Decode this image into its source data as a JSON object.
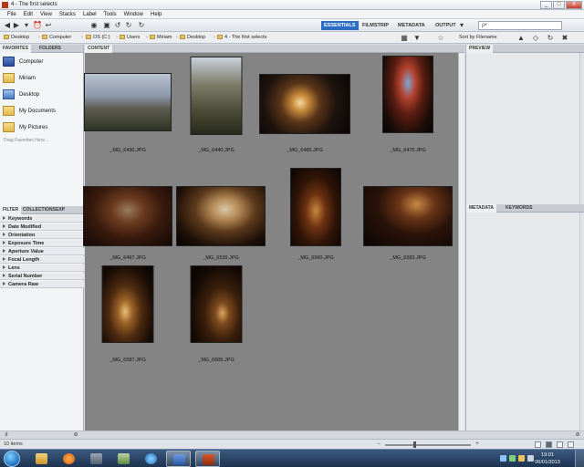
{
  "window": {
    "title": "4 - The first selects",
    "controls": [
      "_",
      "□",
      "X"
    ]
  },
  "menu": [
    "File",
    "Edit",
    "View",
    "Stacks",
    "Label",
    "Tools",
    "Window",
    "Help"
  ],
  "toolbar": {
    "workspaces": [
      "ESSENTIALS",
      "FILMSTRIP",
      "METADATA",
      "OUTPUT"
    ],
    "active_workspace": "ESSENTIALS",
    "search_placeholder": "ρ•"
  },
  "path": {
    "crumbs": [
      "Desktop",
      "Computer",
      "OS (C:)",
      "Users",
      "Miriam",
      "Desktop",
      "4 - The first selects"
    ],
    "sort_label": "Sort by Filename"
  },
  "favorites": {
    "tabs": [
      "FAVORITES",
      "FOLDERS"
    ],
    "items": [
      "Computer",
      "Miriam",
      "Desktop",
      "My Documents",
      "My Pictures"
    ],
    "hint": "Drag Favorites Here..."
  },
  "filter": {
    "tabs": [
      "FILTER",
      "COLLECTIONS",
      "EXP"
    ],
    "rows": [
      "Keywords",
      "Date Modified",
      "Orientation",
      "Exposure Time",
      "Aperture Value",
      "Focal Length",
      "Lens",
      "Serial Number",
      "Camera Raw"
    ]
  },
  "content": {
    "tab": "CONTENT",
    "thumbnails": [
      {
        "name": "_MG_6430.JPG",
        "orientation": "landscape",
        "scene": "church-exterior-dusk"
      },
      {
        "name": "_MG_6440.JPG",
        "orientation": "portrait",
        "scene": "church-exterior-day"
      },
      {
        "name": "_MG_6465.JPG",
        "orientation": "landscape",
        "scene": "lantern-window"
      },
      {
        "name": "_MG_6475.JPG",
        "orientation": "portrait",
        "scene": "stained-glass"
      },
      {
        "name": "_MG_6497.JPG",
        "orientation": "landscape",
        "scene": "church-interior-candles"
      },
      {
        "name": "_MG_6539.JPG",
        "orientation": "landscape",
        "scene": "hymn-sheet-candle"
      },
      {
        "name": "_MG_6560.JPG",
        "orientation": "portrait",
        "scene": "arch-candles"
      },
      {
        "name": "_MG_6583.JPG",
        "orientation": "landscape",
        "scene": "congregation-candles"
      },
      {
        "name": "_MG_6587.JPG",
        "orientation": "portrait",
        "scene": "candle-niche"
      },
      {
        "name": "_MG_6605.JPG",
        "orientation": "portrait",
        "scene": "dark-corner-candle"
      }
    ]
  },
  "right_panels": {
    "preview_tab": "PREVIEW",
    "metadata_tabs": [
      "METADATA",
      "KEYWORDS"
    ]
  },
  "status": {
    "count": "10 items"
  },
  "taskbar": {
    "time": "19:01",
    "date": "06/01/2013"
  }
}
